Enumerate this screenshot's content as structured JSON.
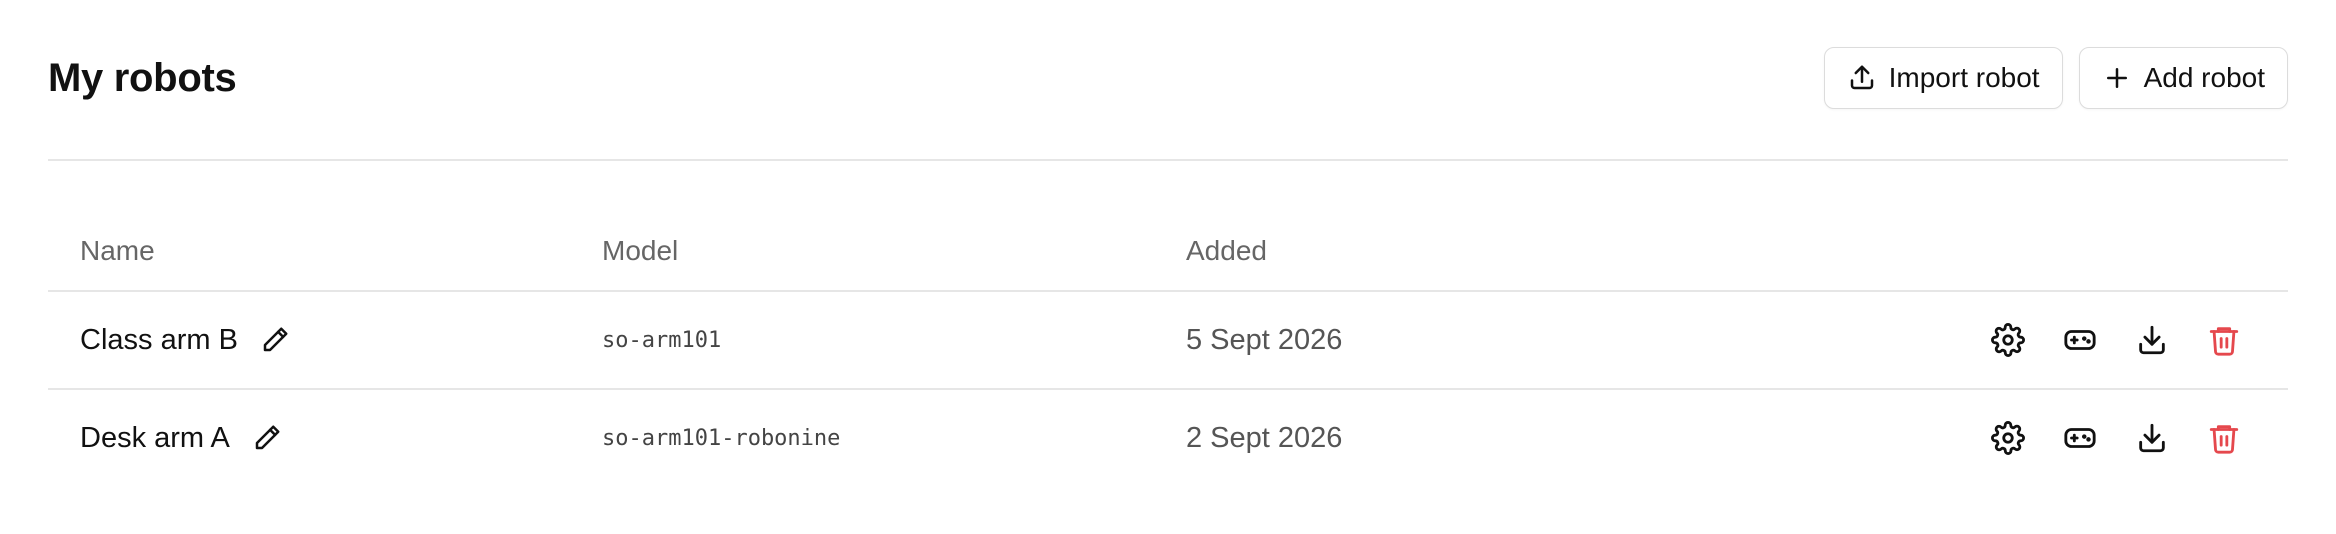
{
  "header": {
    "title": "My robots",
    "import_label": "Import robot",
    "add_label": "Add robot"
  },
  "table": {
    "columns": [
      "Name",
      "Model",
      "Added"
    ],
    "rows": [
      {
        "name": "Class arm B",
        "model": "so-arm101",
        "added": "5 Sept 2026"
      },
      {
        "name": "Desk arm A",
        "model": "so-arm101-robonine",
        "added": "2 Sept 2026"
      }
    ]
  },
  "icons": {
    "import": "upload-icon",
    "add": "plus-icon",
    "edit": "pencil-icon",
    "settings": "gear-icon",
    "control": "gamepad-icon",
    "download": "download-icon",
    "delete": "trash-icon"
  },
  "colors": {
    "text": "#111111",
    "muted": "#666666",
    "border": "#e6e6e6",
    "danger": "#e5484d"
  }
}
